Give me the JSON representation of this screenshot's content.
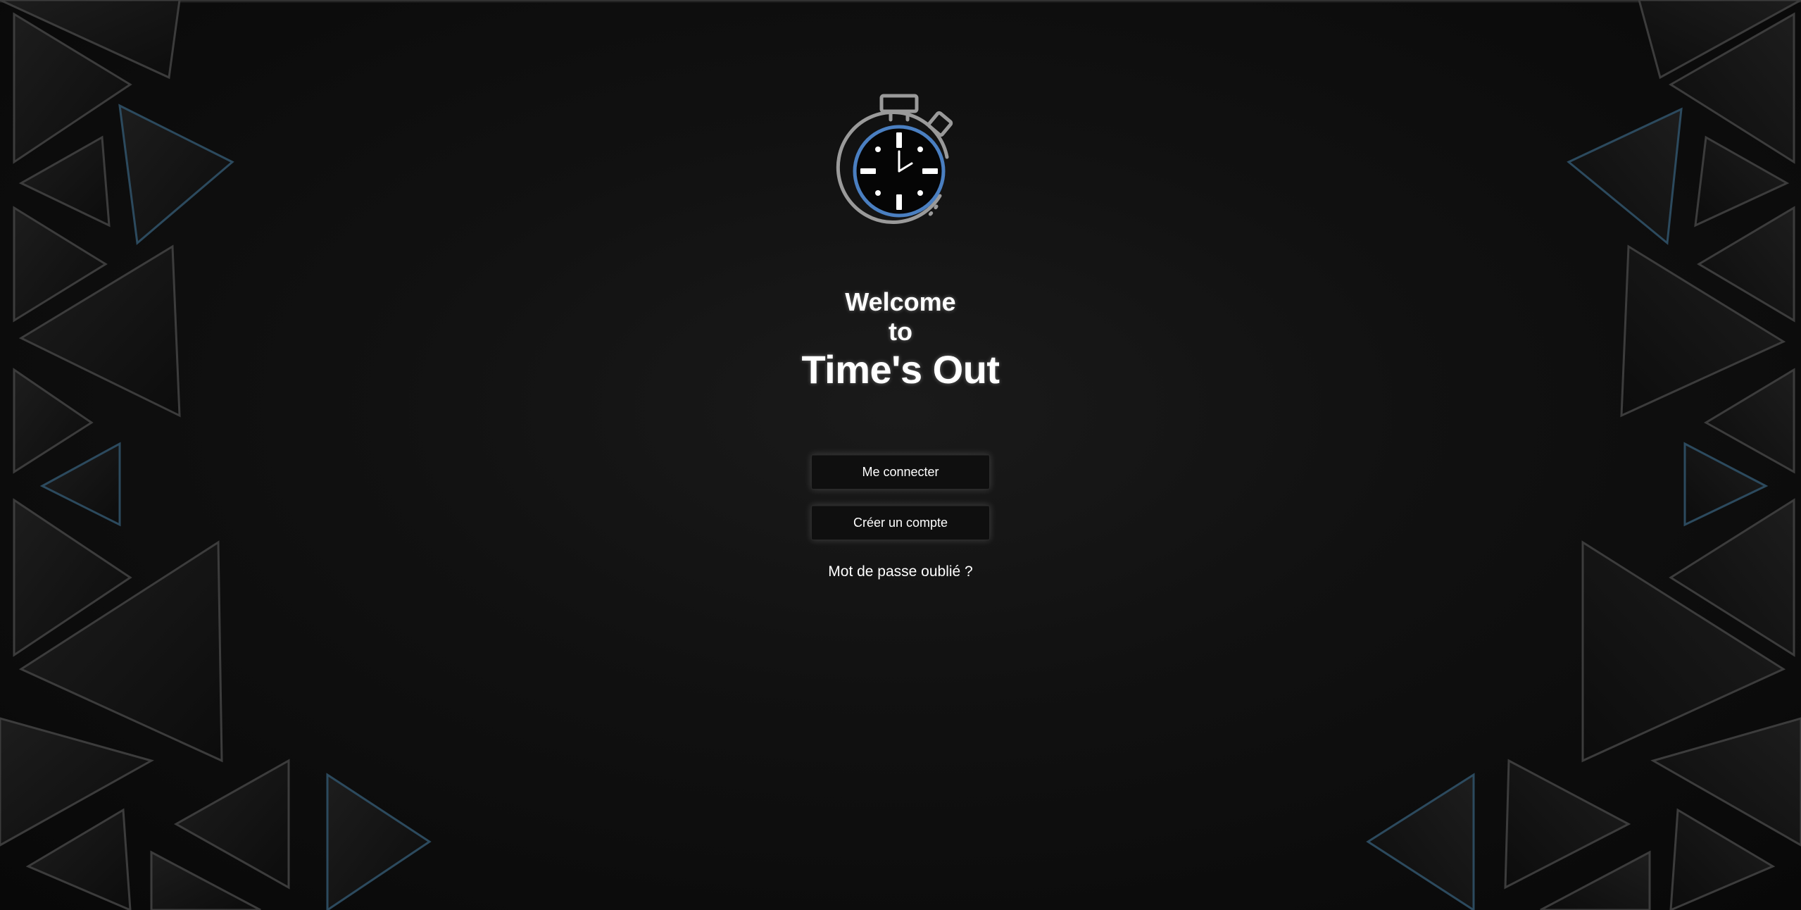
{
  "app": {
    "welcome_line1": "Welcome",
    "welcome_line2": "to",
    "app_name": "Time's Out"
  },
  "actions": {
    "login_label": "Me connecter",
    "signup_label": "Créer un compte",
    "forgot_password_label": "Mot de passe oublié ?"
  },
  "logo": {
    "icon": "stopwatch-icon",
    "ring_color": "#4a7fc1",
    "outline_color": "#9a9a9a"
  },
  "theme": {
    "background": "#0b0b0b",
    "accent": "#2c5a7a",
    "text": "#ffffff"
  }
}
